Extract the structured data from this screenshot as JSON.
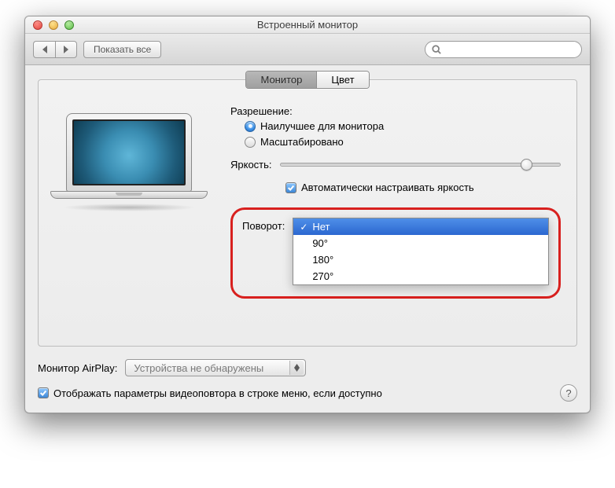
{
  "window": {
    "title": "Встроенный монитор"
  },
  "toolbar": {
    "show_all": "Показать все",
    "search_placeholder": ""
  },
  "tabs": {
    "monitor": "Монитор",
    "color": "Цвет"
  },
  "resolution": {
    "label": "Разрешение:",
    "best": "Наилучшее для монитора",
    "scaled": "Масштабировано"
  },
  "brightness": {
    "label": "Яркость:",
    "auto_label": "Автоматически настраивать яркость",
    "value_percent": 88
  },
  "rotation": {
    "label": "Поворот:",
    "options": {
      "o0": "Нет",
      "o1": "90°",
      "o2": "180°",
      "o3": "270°"
    },
    "selected": "Нет"
  },
  "airplay": {
    "label": "Монитор AirPlay:",
    "value": "Устройства не обнаружены"
  },
  "footer": {
    "mirror_label": "Отображать параметры видеоповтора в строке меню, если доступно",
    "help": "?"
  }
}
